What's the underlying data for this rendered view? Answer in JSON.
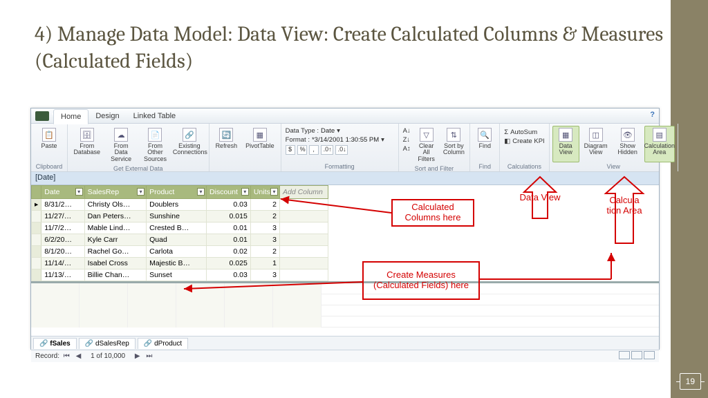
{
  "slide": {
    "title": "4) Manage Data Model: Data View: Create Calculated Columns & Measures (Calculated Fields)",
    "page_number": "19"
  },
  "menubar": {
    "tabs": [
      "Home",
      "Design",
      "Linked Table"
    ],
    "help_symbol": "?"
  },
  "ribbon": {
    "clipboard": {
      "label": "Clipboard",
      "paste": "Paste"
    },
    "get_external": {
      "label": "Get External Data",
      "from_database": "From Database",
      "from_data_service": "From Data Service",
      "from_other_sources": "From Other Sources",
      "existing_connections": "Existing Connections"
    },
    "refresh": "Refresh",
    "pivottable": "PivotTable",
    "formatting": {
      "label": "Formatting",
      "data_type_label": "Data Type :",
      "data_type_value": "Date",
      "format_label": "Format :",
      "format_value": "*3/14/2001 1:30:55 PM",
      "currency": "$",
      "percent": "%",
      "comma": ",",
      "dec_inc": ".0↑",
      "dec_dec": ".0↓"
    },
    "sort_filter": {
      "label": "Sort and Filter",
      "clear_filters": "Clear All Filters",
      "sort_by_column": "Sort by Column"
    },
    "find": {
      "label": "Find",
      "find_btn": "Find"
    },
    "calculations": {
      "label": "Calculations",
      "autosum": "AutoSum",
      "create_kpi": "Create KPI"
    },
    "view": {
      "label": "View",
      "data_view": "Data View",
      "diagram_view": "Diagram View",
      "show_hidden": "Show Hidden",
      "calc_area": "Calculation Area"
    }
  },
  "colname_bar": "[Date]",
  "grid": {
    "headers": [
      "Date",
      "SalesRep",
      "Product",
      "Discount",
      "Units"
    ],
    "add_column": "Add Column",
    "rows": [
      {
        "date": "8/31/2…",
        "rep": "Christy Ols…",
        "product": "Doublers",
        "discount": "0.03",
        "units": "2"
      },
      {
        "date": "11/27/…",
        "rep": "Dan Peters…",
        "product": "Sunshine",
        "discount": "0.015",
        "units": "2"
      },
      {
        "date": "11/7/2…",
        "rep": "Mable Lind…",
        "product": "Crested B…",
        "discount": "0.01",
        "units": "3"
      },
      {
        "date": "6/2/20…",
        "rep": "Kyle Carr",
        "product": "Quad",
        "discount": "0.01",
        "units": "3"
      },
      {
        "date": "8/1/20…",
        "rep": "Rachel Go…",
        "product": "Carlota",
        "discount": "0.02",
        "units": "2"
      },
      {
        "date": "11/14/…",
        "rep": "Isabel Cross",
        "product": "Majestic B…",
        "discount": "0.025",
        "units": "1"
      },
      {
        "date": "11/13/…",
        "rep": "Billie Chan…",
        "product": "Sunset",
        "discount": "0.03",
        "units": "3"
      }
    ]
  },
  "sheet_tabs": [
    "fSales",
    "dSalesRep",
    "dProduct"
  ],
  "status": {
    "record_label": "Record:",
    "position": "1 of 10,000",
    "nav_first": "⏮",
    "nav_prev": "◀",
    "nav_next": "▶",
    "nav_last": "⏭"
  },
  "annotations": {
    "calc_columns": "Calculated Columns here",
    "data_view": "Data View",
    "calc_area": "Calcula tion Area",
    "create_measures": "Create Measures (Calculated Fields) here"
  }
}
